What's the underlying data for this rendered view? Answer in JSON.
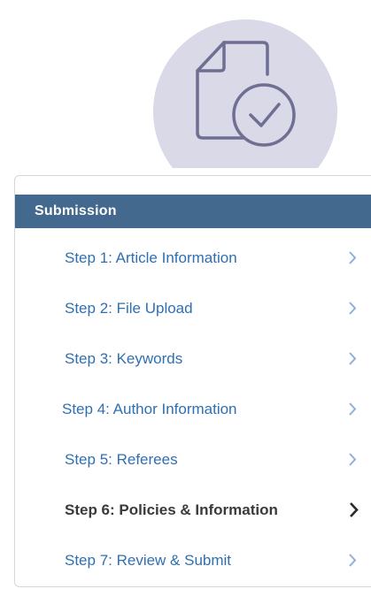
{
  "panel": {
    "header": "Submission",
    "steps": [
      {
        "label": "Step 1: Article Information",
        "active": false
      },
      {
        "label": "Step 2: File Upload",
        "active": false
      },
      {
        "label": "Step 3: Keywords",
        "active": false
      },
      {
        "label": "Step 4: Author Information",
        "active": false
      },
      {
        "label": "Step 5: Referees",
        "active": false
      },
      {
        "label": "Step 6: Policies & Information",
        "active": true
      },
      {
        "label": "Step 7: Review & Submit",
        "active": false
      }
    ]
  },
  "icons": {
    "hero": "document-check-icon",
    "chevron": "chevron-right-icon"
  },
  "colors": {
    "header_bg": "#44698f",
    "link": "#2f6fb3",
    "active_text": "#3a3a3a",
    "chevron": "#8fb0d6",
    "hero_circle": "#d9d9e8",
    "hero_stroke": "#6e6f93"
  }
}
